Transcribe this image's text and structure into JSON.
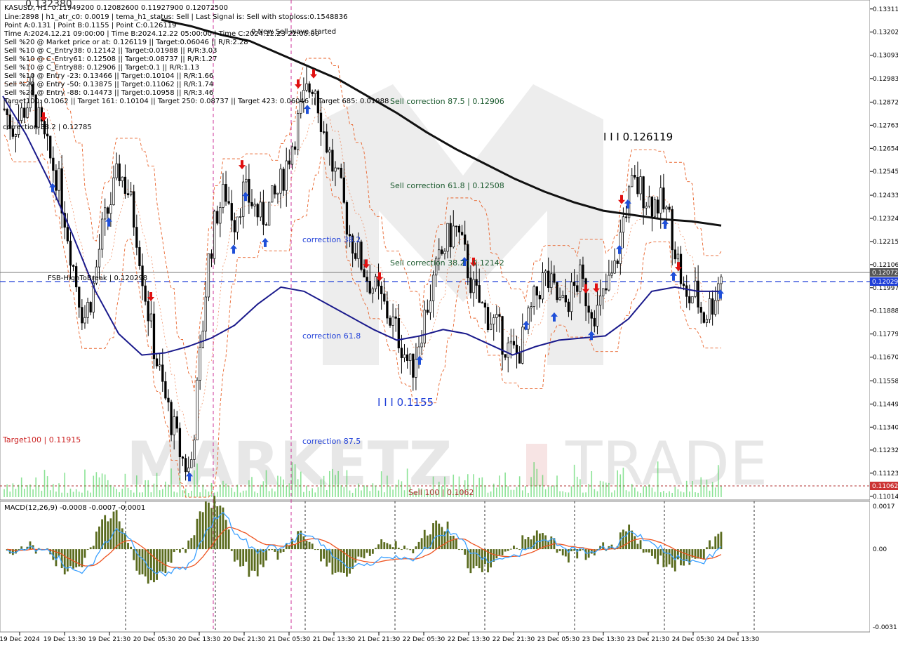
{
  "header": {
    "symbol_line": "KASUSD, H1: 0.11949200 0.12082600 0.11927900 0.12072500",
    "info_lines": [
      "Line:2898 | h1_atr_c0: 0.0019 | tema_h1_status: Sell | Last Signal is: Sell with stoploss:0.1548836",
      "Point A:0.131 | Point B:0.1155 | Point C:0.126119",
      "Time A:2024.12.21 09:00:00 | Time B:2024.12.22 05:00:00 | Time C:2024.12.23 22:00:00",
      "Sell %20 @ Market price or at: 0.126119 || Target:0.06046 || R/R:2.28",
      "Sell %10 @ C_Entry38: 0.12142 || Target:0.01988 || R/R:3.03",
      "Sell %10 @ C_Entry61: 0.12508 || Target:0.08737 || R/R:1.27",
      "Sell %10 @ C_Entry88: 0.12906 || Target:0.1 || R/R:1.13",
      "Sell %10 @ Entry -23: 0.13466 || Target:0.10104 || R/R:1.66",
      "Sell %20 @ Entry -50: 0.13875 || Target:0.11062 || R/R:1.74",
      "Sell %20 @ Entry -88: 0.14473 || Target:0.10958 || R/R:3.46",
      "Target100: 0.1062 || Target 161: 0.10104 || Target 250: 0.08737 || Target 423: 0.06046 || Target 685: 0.01988"
    ]
  },
  "annotations": {
    "wave_start": "0 New Sell wave started",
    "point_c": "I I I 0.126119",
    "point_b": "I I I 0.1155",
    "sell_corr_875": "Sell correction 87.5 | 0.12906",
    "sell_corr_618": "Sell correction 61.8 | 0.12508",
    "sell_corr_382": "Sell correction 38.2 | 0.12142",
    "corr_382": "correction 38.2",
    "corr_618": "correction 61.8",
    "corr_875": "correction 87.5",
    "fsb": "FSB-HighToBreak | 0.120298",
    "sell_100": "Sell 100 | 0.1062",
    "target_left": "Target100 | 0.11915",
    "top_left_price": "0.132380",
    "left_corr": "correction 38.2 | 0.12785"
  },
  "watermark": {
    "left": "MARKETZ",
    "mid": "I",
    "right": "TRADE"
  },
  "colors": {
    "buy_arrow": "#1f4fd8",
    "sell_arrow": "#e01010",
    "ma200": "#111111",
    "ma_blue": "#1a1a8c",
    "bands": "#e8632b",
    "macd_hist": "#5a6b1e",
    "macd_signal": "#ee5522",
    "macd_line": "#3aa0ff",
    "price_box_gray": "#555555",
    "price_box_blue": "#1f3fd8",
    "price_box_red": "#cc3333"
  },
  "macd": {
    "label": "MACD(12,26,9) -0.0008 -0.0007 -0.0001",
    "ticks": [
      "0.0017",
      "0.00",
      "-0.0031"
    ]
  },
  "price_axis": {
    "ticks": [
      "0.13311",
      "0.13202",
      "0.13093",
      "0.12983",
      "0.12872",
      "0.12763",
      "0.12654",
      "0.12545",
      "0.12433",
      "0.12324",
      "0.12215",
      "0.12106",
      "0.11997",
      "0.11888",
      "0.11779",
      "0.11670",
      "0.11558",
      "0.11449",
      "0.11340",
      "0.11232",
      "0.11123",
      "0.11014"
    ],
    "current_price": "0.12072",
    "fsb_price": "0.12029",
    "sell100_price": "0.11062"
  },
  "time_axis": {
    "labels": [
      "19 Dec 2024",
      "19 Dec 13:30",
      "19 Dec 21:30",
      "20 Dec 05:30",
      "20 Dec 13:30",
      "20 Dec 21:30",
      "21 Dec 05:30",
      "21 Dec 13:30",
      "21 Dec 21:30",
      "22 Dec 05:30",
      "22 Dec 13:30",
      "22 Dec 21:30",
      "23 Dec 05:30",
      "23 Dec 13:30",
      "23 Dec 21:30",
      "24 Dec 05:30",
      "24 Dec 13:30"
    ]
  },
  "chart_data": {
    "type": "line",
    "title": "KASUSD, H1",
    "series": [
      {
        "name": "Close",
        "values": [
          0.1284,
          0.1275,
          0.1282,
          0.129,
          0.1276,
          0.1262,
          0.1252,
          0.123,
          0.1205,
          0.1185,
          0.1198,
          0.1225,
          0.124,
          0.1255,
          0.1245,
          0.1225,
          0.1195,
          0.117,
          0.115,
          0.1135,
          0.112,
          0.1112,
          0.116,
          0.121,
          0.1235,
          0.1245,
          0.1232,
          0.1245,
          0.124,
          0.1232,
          0.1238,
          0.1245,
          0.126,
          0.1275,
          0.129,
          0.1298,
          0.1275,
          0.1258,
          0.1245,
          0.1225,
          0.1215,
          0.1205,
          0.1198,
          0.119,
          0.1182,
          0.1172,
          0.116,
          0.1178,
          0.1195,
          0.121,
          0.1222,
          0.1228,
          0.1215,
          0.1198,
          0.119,
          0.1185,
          0.1178,
          0.117,
          0.1168,
          0.118,
          0.1195,
          0.1205,
          0.1198,
          0.119,
          0.1196,
          0.1204,
          0.1193,
          0.1188,
          0.1198,
          0.1208,
          0.1234,
          0.1248,
          0.1246,
          0.124,
          0.124,
          0.1234,
          0.1215,
          0.1192,
          0.1198,
          0.1186,
          0.1193,
          0.1207
        ]
      },
      {
        "name": "MA200",
        "values": [
          0.1326,
          0.1323,
          0.1319,
          0.1316,
          0.131,
          0.1304,
          0.1298,
          0.129,
          0.1282,
          0.1273,
          0.1265,
          0.1258,
          0.1251,
          0.1245,
          0.124,
          0.1236,
          0.1234,
          0.1232,
          0.1231,
          0.1229
        ]
      },
      {
        "name": "MA",
        "values": [
          0.129,
          0.1272,
          0.125,
          0.1225,
          0.1198,
          0.1178,
          0.1168,
          0.1169,
          0.1172,
          0.1176,
          0.1182,
          0.1192,
          0.12,
          0.1198,
          0.1192,
          0.1186,
          0.118,
          0.1175,
          0.1177,
          0.118,
          0.1178,
          0.1173,
          0.1168,
          0.1172,
          0.1175,
          0.1176,
          0.1177,
          0.1185,
          0.1198,
          0.12,
          0.1198,
          0.1198
        ]
      }
    ],
    "ylim": [
      0.1101,
      0.1334
    ]
  }
}
